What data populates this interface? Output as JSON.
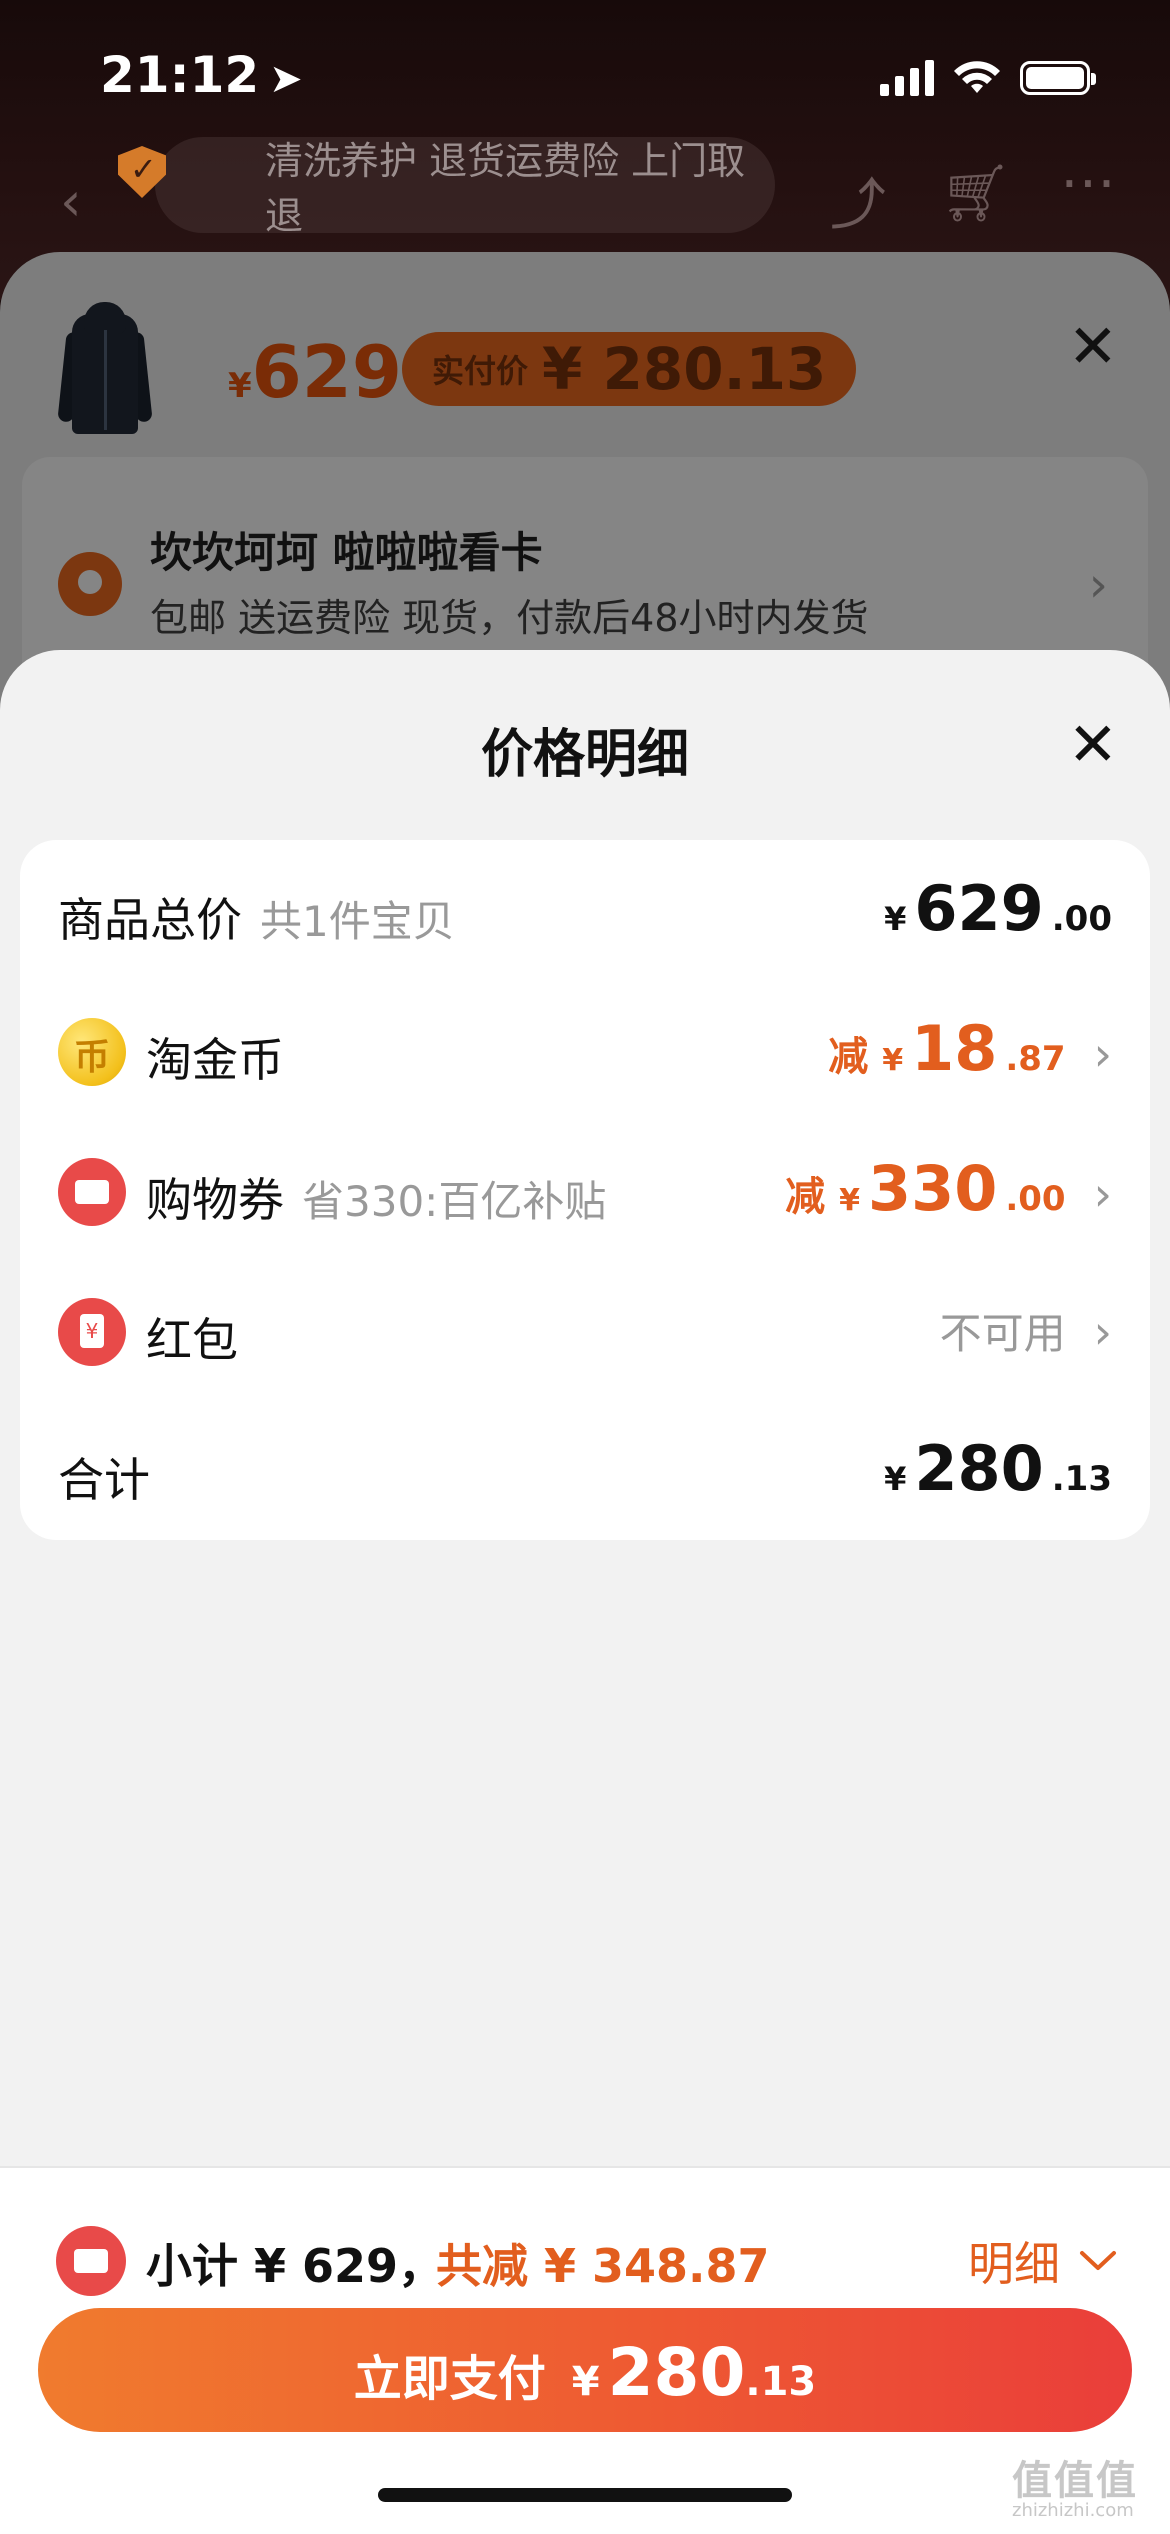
{
  "status_bar": {
    "time": "21:12",
    "location_icon": "location-arrow-icon",
    "icons": [
      "signal-icon",
      "wifi-icon",
      "battery-icon"
    ]
  },
  "top_bar": {
    "service_text": "清洗养护 退货运费险 上门取退"
  },
  "product_sheet": {
    "price_currency": "¥",
    "price": "629",
    "real_pay_label": "实付价",
    "real_pay_value": "¥ 280.13",
    "address_name": "坎坎坷坷 啦啦啦看卡",
    "delivery_text": "包邮  送运费险  现货，付款后48小时内发货"
  },
  "price_detail": {
    "title": "价格明细",
    "rows": [
      {
        "label": "商品总价",
        "note": "共1件宝贝",
        "currency": "¥",
        "amount_int": "629",
        "amount_dec": ".00"
      },
      {
        "label": "淘金币",
        "prefix": "减",
        "currency": "¥",
        "amount_int": "18",
        "amount_dec": ".87",
        "icon": "coin-icon"
      },
      {
        "label": "购物券",
        "note": "省330:百亿补贴",
        "prefix": "减",
        "currency": "¥",
        "amount_int": "330",
        "amount_dec": ".00",
        "icon": "ticket-icon"
      },
      {
        "label": "红包",
        "status": "不可用",
        "icon": "red-packet-icon"
      },
      {
        "label": "合计",
        "currency": "¥",
        "amount_int": "280",
        "amount_dec": ".13"
      }
    ]
  },
  "bottom_bar": {
    "subtotal": "小计 ¥ 629，",
    "saved": "共减 ¥ 348.87",
    "detail_link": "明细",
    "pay_label": "立即支付",
    "pay_currency": "¥",
    "pay_int": "280",
    "pay_dec": ".13"
  },
  "watermark": {
    "logo": "值值值",
    "site": "zhizhizhi.com"
  },
  "colors": {
    "accent": "#e25e1e",
    "pay_gradient_start": "#f07b2e",
    "pay_gradient_end": "#ea3e3a",
    "sheet_bg": "#f2f2f2"
  }
}
